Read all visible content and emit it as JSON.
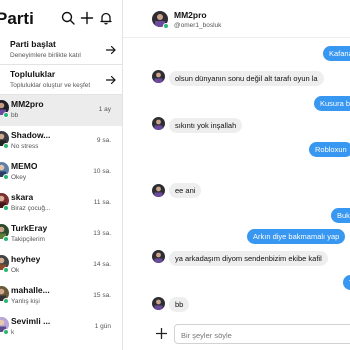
{
  "sidebar": {
    "title": "Parti",
    "icons": [
      "search-icon",
      "plus-icon",
      "bell-icon"
    ],
    "actions": [
      {
        "title": "Parti başlat",
        "subtitle": "Deneyimlere birlikte katıl"
      },
      {
        "title": "Topluluklar",
        "subtitle": "Topluluklar oluştur ve keşfet"
      }
    ],
    "conversations": [
      {
        "name": "MM2pro",
        "preview": "bb",
        "time": "1 ay",
        "selected": true
      },
      {
        "name": "Shadow...",
        "preview": "No stress",
        "time": "9 sa."
      },
      {
        "name": "MEMO",
        "preview": "Okey",
        "time": "10 sa."
      },
      {
        "name": "skara",
        "preview": "Biraz çocuğ...",
        "time": "11 sa."
      },
      {
        "name": "TurkEray",
        "preview": "Takipçilerim",
        "time": "13 sa."
      },
      {
        "name": "heyhey",
        "preview": "Ok",
        "time": "14 sa."
      },
      {
        "name": "mahalle...",
        "preview": "Yanlış kişi",
        "time": "15 sa."
      },
      {
        "name": "Sevimli ...",
        "preview": "k",
        "time": "1 gün"
      }
    ]
  },
  "chat": {
    "name": "MM2pro",
    "username": "@omer1_bosluk",
    "messages": [
      {
        "dir": "out",
        "text": "Kafana"
      },
      {
        "dir": "in",
        "text": "olsun dünyanın sonu değil alt tarafı oyun la"
      },
      {
        "dir": "out",
        "text": "Kusura b"
      },
      {
        "dir": "in",
        "text": "sıkıntı yok inşallah"
      },
      {
        "dir": "out",
        "text": "Robloxun"
      },
      {
        "dir": "in",
        "text": "ee ani"
      },
      {
        "dir": "out",
        "text": "Buka"
      },
      {
        "dir": "out",
        "text": "Arkın diye bakmamalı yap"
      },
      {
        "dir": "in",
        "text": "ya arkadaşım diyom sendenbizim ekibe kafil"
      },
      {
        "dir": "out",
        "text": "Ti"
      },
      {
        "dir": "in",
        "text": "bb"
      }
    ],
    "composer": {
      "placeholder": "Bir şeyler söyle"
    }
  },
  "colors": {
    "accent": "#3897f0",
    "online": "#2bb673",
    "incoming_bubble": "#eeeeee",
    "selected_row": "#ececec"
  }
}
